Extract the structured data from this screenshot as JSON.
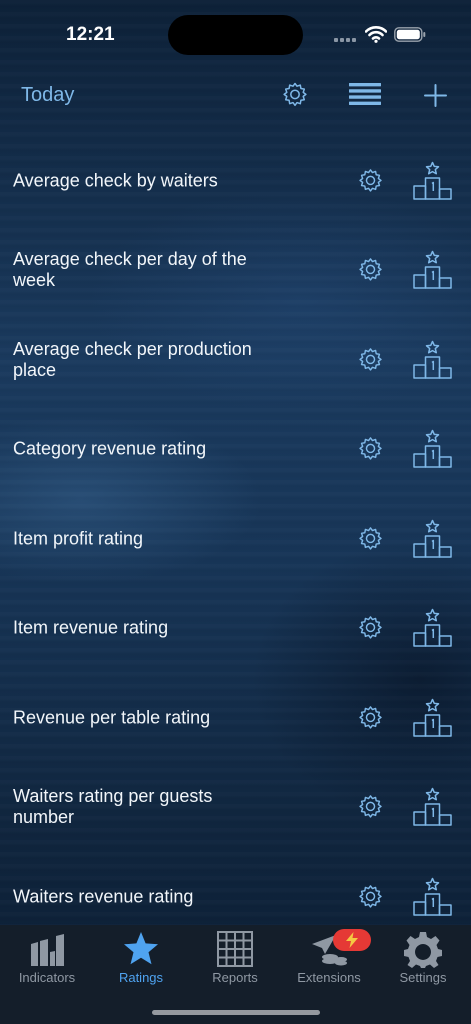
{
  "status_bar": {
    "time": "12:21"
  },
  "nav": {
    "today_label": "Today"
  },
  "rows": [
    {
      "label": "Average check by waiters"
    },
    {
      "label": "Average check per day of the week"
    },
    {
      "label": "Average check per production place"
    },
    {
      "label": "Category revenue rating"
    },
    {
      "label": "Item profit rating"
    },
    {
      "label": "Item revenue rating"
    },
    {
      "label": "Revenue per table rating"
    },
    {
      "label": "Waiters rating per guests number"
    },
    {
      "label": "Waiters revenue rating"
    }
  ],
  "row_icons": {
    "settings": "gear-icon",
    "rating": "podium-star-icon"
  },
  "tabs": [
    {
      "label": "Indicators",
      "icon": "indicators-icon",
      "active": false
    },
    {
      "label": "Ratings",
      "icon": "star-icon",
      "active": true
    },
    {
      "label": "Reports",
      "icon": "grid-icon",
      "active": false
    },
    {
      "label": "Extensions",
      "icon": "extensions-icon",
      "active": false
    },
    {
      "label": "Settings",
      "icon": "gear-icon",
      "active": false
    }
  ],
  "colors": {
    "accent": "#7fb8e8",
    "tab_active": "#4fa3f0",
    "tab_inactive": "#8f98a3",
    "badge": "#e53935",
    "tabbar_bg": "#141e2a"
  }
}
